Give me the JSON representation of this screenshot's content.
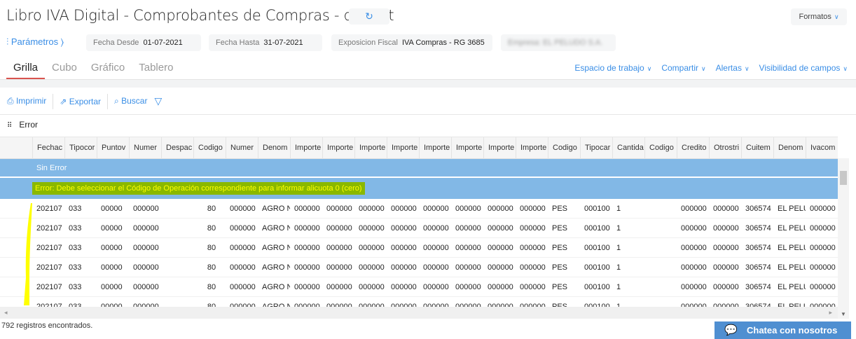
{
  "header": {
    "title": "Libro IVA Digital - Comprobantes de Compras - default",
    "formatos": "Formatos"
  },
  "params": {
    "label": "Parámetros",
    "fecha_desde_label": "Fecha Desde",
    "fecha_desde": "01-07-2021",
    "fecha_hasta_label": "Fecha Hasta",
    "fecha_hasta": "31-07-2021",
    "exposicion_label": "Exposicion Fiscal",
    "exposicion": "IVA Compras - RG 3685",
    "empresa_blurred": "Empresa: EL PELUDO S.A."
  },
  "tabs": [
    "Grilla",
    "Cubo",
    "Gráfico",
    "Tablero"
  ],
  "right_menu": [
    "Espacio de trabajo",
    "Compartir",
    "Alertas",
    "Visibilidad de campos"
  ],
  "toolbar": {
    "print": "Imprimir",
    "export": "Exportar",
    "search": "Buscar"
  },
  "group_by": "Error",
  "columns": [
    "Fechac",
    "Tipocor",
    "Puntov",
    "Numer",
    "Despac",
    "Codigo",
    "Numer",
    "Denom",
    "Importe",
    "Importe",
    "Importe",
    "Importe",
    "Importe",
    "Importe",
    "Importe",
    "Importe",
    "Codigo",
    "Tipocar",
    "Cantida",
    "Codigo",
    "Credito",
    "Otrostri",
    "Cuitem",
    "Denom",
    "Ivacom"
  ],
  "groups": {
    "sin_error": "Sin Error",
    "error": "Error: Debe seleccionar el Código de Operación correspondiente para informar alicuota 0 (cero)"
  },
  "row_values": [
    "202107",
    "033",
    "00000",
    "000000",
    "",
    "80",
    "000000",
    "AGRO N",
    "000000",
    "000000",
    "000000",
    "000000",
    "000000",
    "000000",
    "000000",
    "000000",
    "PES",
    "000100",
    "1",
    "",
    "000000",
    "000000",
    "306574",
    "EL PELU",
    "000000"
  ],
  "row_count": 6,
  "footer": "792 registros encontrados.",
  "chat": "Chatea con nosotros",
  "colors": {
    "accent": "#3a8ee6",
    "group_band": "#82b8e6",
    "highlight": "#ffff00"
  }
}
